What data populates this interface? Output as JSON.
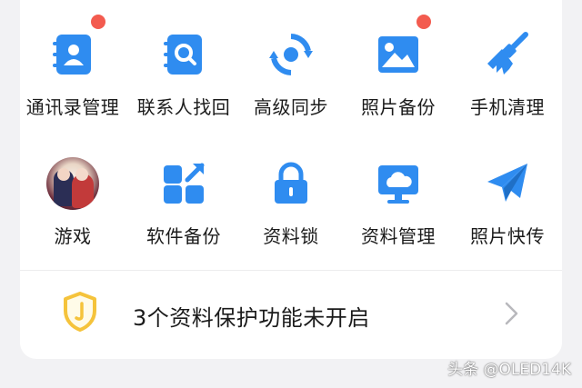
{
  "grid": {
    "row1": [
      {
        "label": "通讯录管理",
        "icon": "contacts-book-icon",
        "badge": true
      },
      {
        "label": "联系人找回",
        "icon": "contact-search-icon",
        "badge": false
      },
      {
        "label": "高级同步",
        "icon": "sync-icon",
        "badge": false
      },
      {
        "label": "照片备份",
        "icon": "photo-icon",
        "badge": true
      },
      {
        "label": "手机清理",
        "icon": "broom-icon",
        "badge": false
      }
    ],
    "row2": [
      {
        "label": "游戏",
        "icon": "game-avatar-icon",
        "badge": false
      },
      {
        "label": "软件备份",
        "icon": "app-backup-icon",
        "badge": false
      },
      {
        "label": "资料锁",
        "icon": "lock-icon",
        "badge": false
      },
      {
        "label": "资料管理",
        "icon": "cloud-monitor-icon",
        "badge": false
      },
      {
        "label": "照片快传",
        "icon": "paper-plane-icon",
        "badge": false
      }
    ]
  },
  "alert": {
    "text": "3个资料保护功能未开启",
    "icon": "shield-icon"
  },
  "watermark": "头条 @OLED14K",
  "colors": {
    "accent": "#2f8cf0",
    "badge": "#f35b4f",
    "shield": "#f5c33b"
  }
}
